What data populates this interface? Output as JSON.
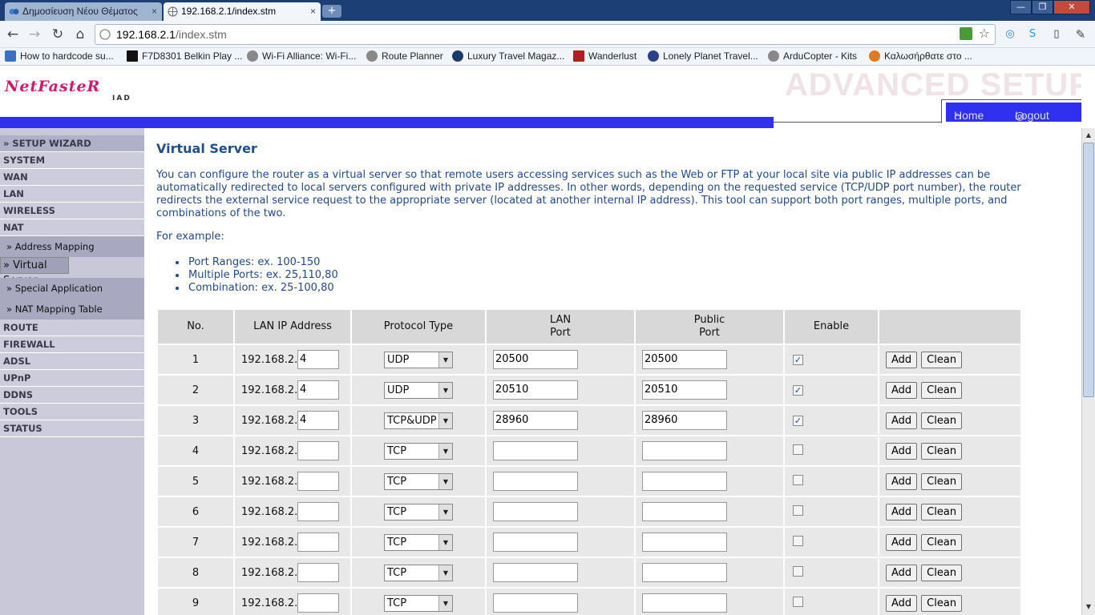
{
  "browser": {
    "tabs": [
      {
        "label": "Δημοσίευση Νέου Θέματος",
        "close": "×"
      },
      {
        "label": "192.168.2.1/index.stm",
        "close": "×"
      }
    ],
    "new_tab": "+",
    "window_buttons": [
      "—",
      "❐",
      "✕"
    ],
    "url_host": "192.168.2.1",
    "url_path": "/index.stm",
    "bookmarks": [
      "How to hardcode su...",
      "F7D8301 Belkin Play ...",
      "Wi-Fi Alliance: Wi-Fi...",
      "Route Planner",
      "Luxury Travel Magaz...",
      "Wanderlust",
      "Lonely Planet Travel...",
      "ArduCopter - Kits",
      "Καλωσήρθατε στο ..."
    ]
  },
  "header": {
    "logo": "NetFasteR",
    "logo_sub": "IAD",
    "banner": "ADVANCED SETUP",
    "home_label": "Home",
    "logout_label": "Logout"
  },
  "sidebar": {
    "top_items": [
      "» SETUP WIZARD",
      "SYSTEM",
      "WAN",
      "LAN",
      "WIRELESS",
      "NAT"
    ],
    "nat_sub": [
      "» Address Mapping",
      "» Virtual Server",
      "» Special Application",
      "» NAT Mapping Table"
    ],
    "bottom_items": [
      "ROUTE",
      "FIREWALL",
      "ADSL",
      "UPnP",
      "DDNS",
      "TOOLS",
      "STATUS"
    ]
  },
  "content": {
    "title": "Virtual Server",
    "description": "You can configure the router as a virtual server so that remote users accessing services such as the Web or FTP at your local site via public IP addresses can be automatically redirected to local servers configured with private IP addresses. In other words, depending on the requested service (TCP/UDP port number), the router redirects the external service request to the appropriate server (located at another internal IP address). This tool can support both port ranges, multiple ports, and combinations of the two.",
    "example_label": "For example:",
    "examples": [
      "Port Ranges: ex. 100-150",
      "Multiple Ports: ex. 25,110,80",
      "Combination: ex. 25-100,80"
    ]
  },
  "table": {
    "headers": {
      "no": "No.",
      "ip": "LAN IP Address",
      "proto": "Protocol Type",
      "lan_port_1": "LAN",
      "lan_port_2": "Port",
      "pub_port_1": "Public",
      "pub_port_2": "Port",
      "enable": "Enable"
    },
    "ip_prefix": "192.168.2.",
    "add_label": "Add",
    "clean_label": "Clean",
    "rows": [
      {
        "no": "1",
        "octet": "4",
        "proto": "UDP",
        "lan_port": "20500",
        "pub_port": "20500",
        "enabled": true
      },
      {
        "no": "2",
        "octet": "4",
        "proto": "UDP",
        "lan_port": "20510",
        "pub_port": "20510",
        "enabled": true
      },
      {
        "no": "3",
        "octet": "4",
        "proto": "TCP&UDP",
        "lan_port": "28960",
        "pub_port": "28960",
        "enabled": true
      },
      {
        "no": "4",
        "octet": "",
        "proto": "TCP",
        "lan_port": "",
        "pub_port": "",
        "enabled": false
      },
      {
        "no": "5",
        "octet": "",
        "proto": "TCP",
        "lan_port": "",
        "pub_port": "",
        "enabled": false
      },
      {
        "no": "6",
        "octet": "",
        "proto": "TCP",
        "lan_port": "",
        "pub_port": "",
        "enabled": false
      },
      {
        "no": "7",
        "octet": "",
        "proto": "TCP",
        "lan_port": "",
        "pub_port": "",
        "enabled": false
      },
      {
        "no": "8",
        "octet": "",
        "proto": "TCP",
        "lan_port": "",
        "pub_port": "",
        "enabled": false
      },
      {
        "no": "9",
        "octet": "",
        "proto": "TCP",
        "lan_port": "",
        "pub_port": "",
        "enabled": false
      }
    ]
  },
  "colors": {
    "accent": "#3030f0",
    "text": "#224a8a",
    "sidebar": "#ccccdc"
  }
}
